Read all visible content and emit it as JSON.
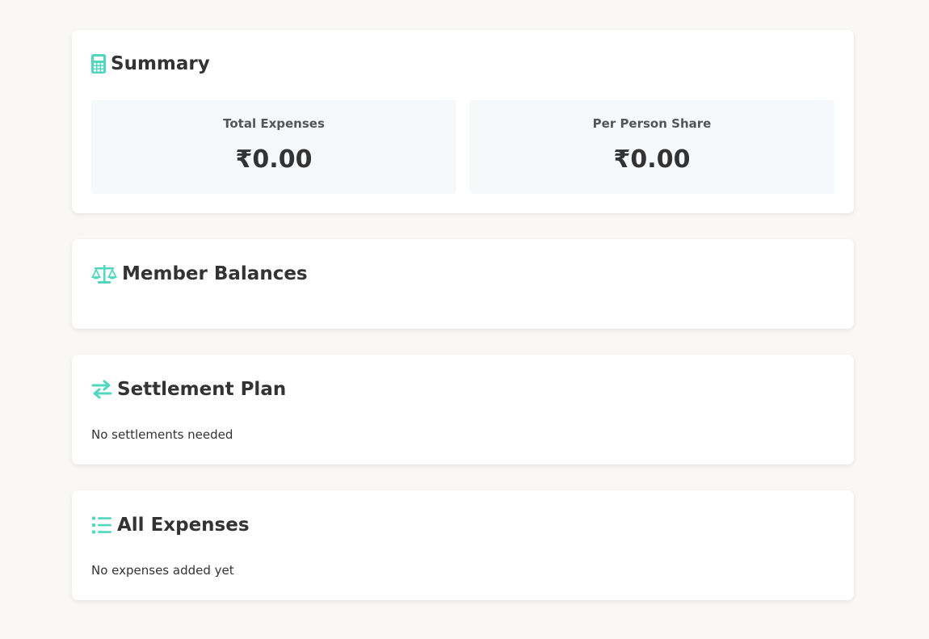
{
  "accent_color": "#4fd8bf",
  "summary": {
    "title": "Summary",
    "icon": "calculator-icon",
    "total_label": "Total Expenses",
    "total_value": "₹0.00",
    "share_label": "Per Person Share",
    "share_value": "₹0.00"
  },
  "balances": {
    "title": "Member Balances",
    "icon": "balance-scale-icon"
  },
  "settlement": {
    "title": "Settlement Plan",
    "icon": "exchange-arrows-icon",
    "empty_text": "No settlements needed"
  },
  "expenses": {
    "title": "All Expenses",
    "icon": "list-icon",
    "empty_text": "No expenses added yet"
  }
}
